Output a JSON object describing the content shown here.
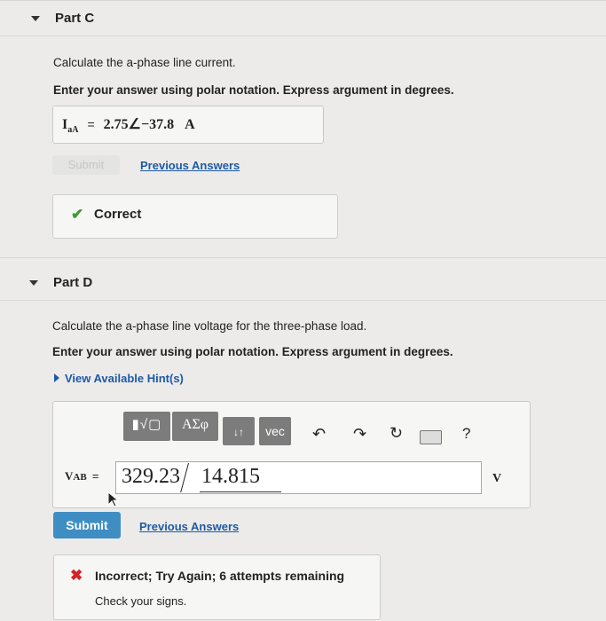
{
  "partC": {
    "title": "Part C",
    "prompt": "Calculate the a-phase line current.",
    "instruction": "Enter your answer using polar notation. Express argument in degrees.",
    "answer_var_main": "I",
    "answer_var_sub": "aA",
    "equals": "=",
    "answer_value": "2.75∠−37.8",
    "answer_unit": "A",
    "submit_label": "Submit",
    "previous_answers_label": "Previous Answers",
    "feedback_label": "Correct"
  },
  "partD": {
    "title": "Part D",
    "prompt": "Calculate the a-phase line voltage for the three-phase load.",
    "instruction": "Enter your answer using polar notation. Express argument in degrees.",
    "hint_label": "View Available Hint(s)",
    "toolbar": {
      "templates_label": "▮√▢",
      "greek_label": "ΑΣφ",
      "subscript_label": "↓↑",
      "vec_label": "vec",
      "help_label": "?"
    },
    "answer_var_main": "V",
    "answer_var_sub": "AB",
    "equals": "=",
    "magnitude": "329.23",
    "angle": "14.815",
    "answer_unit": "V",
    "submit_label": "Submit",
    "previous_answers_label": "Previous Answers",
    "feedback_title": "Incorrect; Try Again; 6 attempts remaining",
    "feedback_detail": "Check your signs."
  }
}
